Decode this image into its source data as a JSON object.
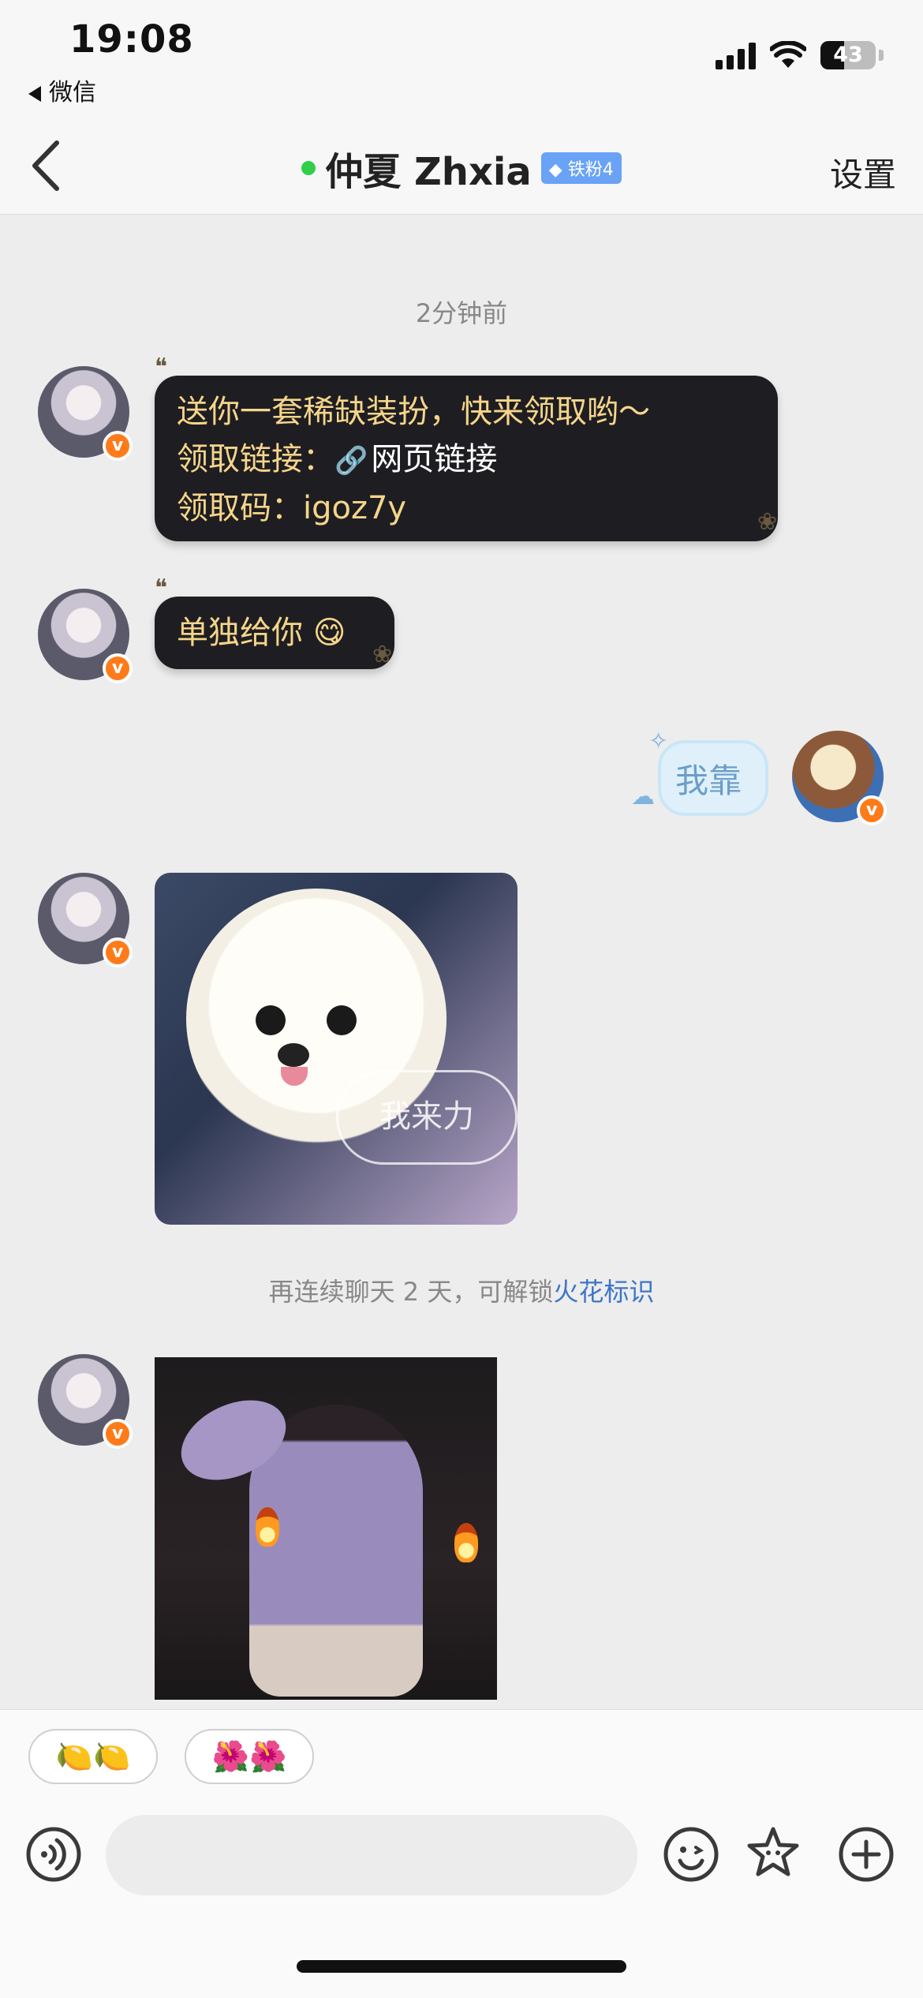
{
  "status_bar": {
    "time": "19:08",
    "back_app": "微信",
    "battery": "43"
  },
  "nav": {
    "title": "仲夏 Zhxia",
    "fan_badge": "铁粉4",
    "settings": "设置"
  },
  "chat": {
    "time_label": "2分钟前",
    "msg1": {
      "line1": "送你一套稀缺装扮，快来领取哟～",
      "line2_label": "领取链接：",
      "link_text": "网页链接",
      "line3": "领取码：igoz7y"
    },
    "msg2": {
      "text": "单独给你",
      "emoji": "😋"
    },
    "msg_mine": {
      "text": "我靠"
    },
    "photo1": {
      "caption": "我来力"
    },
    "hint": {
      "text": "再连续聊天 2 天，可解锁",
      "link": "火花标识"
    }
  },
  "quick_replies": [
    "🍋🍋",
    "🌺🌺"
  ],
  "input": {
    "placeholder": ""
  },
  "colors": {
    "accent_blue": "#3c76c7",
    "badge_orange": "#ff7b1a",
    "bubble_dark": "#1e1e22",
    "bubble_text_gold": "#f6d58a",
    "online_green": "#2fcf4a"
  }
}
